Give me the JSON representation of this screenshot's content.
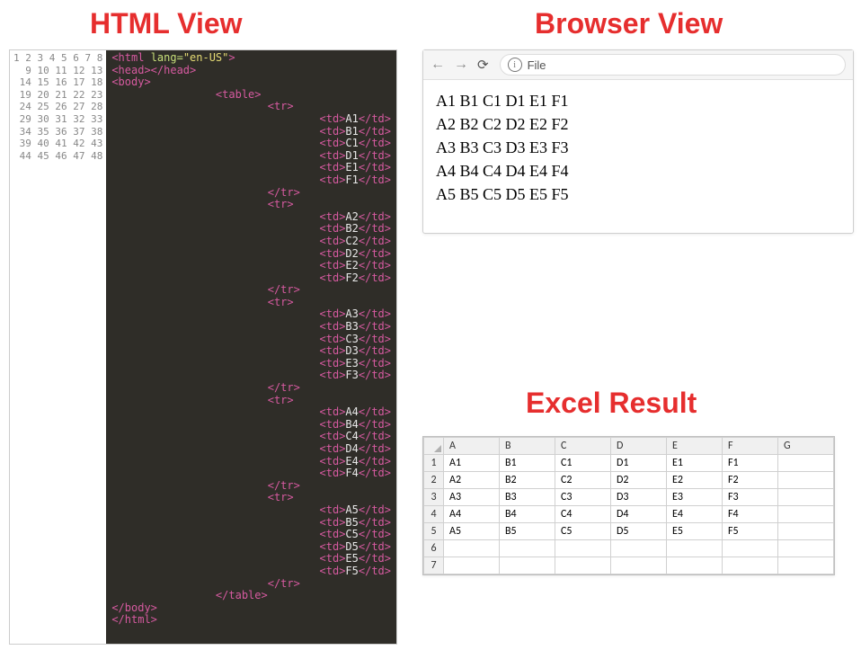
{
  "titles": {
    "html_view": "HTML View",
    "browser_view": "Browser View",
    "excel_result": "Excel Result"
  },
  "code": {
    "lang": "en-US",
    "lines": 48,
    "rows": [
      [
        "A1",
        "B1",
        "C1",
        "D1",
        "E1",
        "F1"
      ],
      [
        "A2",
        "B2",
        "C2",
        "D2",
        "E2",
        "F2"
      ],
      [
        "A3",
        "B3",
        "C3",
        "D3",
        "E3",
        "F3"
      ],
      [
        "A4",
        "B4",
        "C4",
        "D4",
        "E4",
        "F4"
      ],
      [
        "A5",
        "B5",
        "C5",
        "D5",
        "E5",
        "F5"
      ]
    ]
  },
  "browser": {
    "url_label": "File",
    "rows": [
      "A1 B1 C1 D1 E1 F1",
      "A2 B2 C2 D2 E2 F2",
      "A3 B3 C3 D3 E3 F3",
      "A4 B4 C4 D4 E4 F4",
      "A5 B5 C5 D5 E5 F5"
    ]
  },
  "excel": {
    "column_headers": [
      "A",
      "B",
      "C",
      "D",
      "E",
      "F",
      "G"
    ],
    "row_headers": [
      "1",
      "2",
      "3",
      "4",
      "5",
      "6",
      "7"
    ],
    "cells": [
      [
        "A1",
        "B1",
        "C1",
        "D1",
        "E1",
        "F1",
        ""
      ],
      [
        "A2",
        "B2",
        "C2",
        "D2",
        "E2",
        "F2",
        ""
      ],
      [
        "A3",
        "B3",
        "C3",
        "D3",
        "E3",
        "F3",
        ""
      ],
      [
        "A4",
        "B4",
        "C4",
        "D4",
        "E4",
        "F4",
        ""
      ],
      [
        "A5",
        "B5",
        "C5",
        "D5",
        "E5",
        "F5",
        ""
      ],
      [
        "",
        "",
        "",
        "",
        "",
        "",
        ""
      ],
      [
        "",
        "",
        "",
        "",
        "",
        "",
        ""
      ]
    ]
  }
}
